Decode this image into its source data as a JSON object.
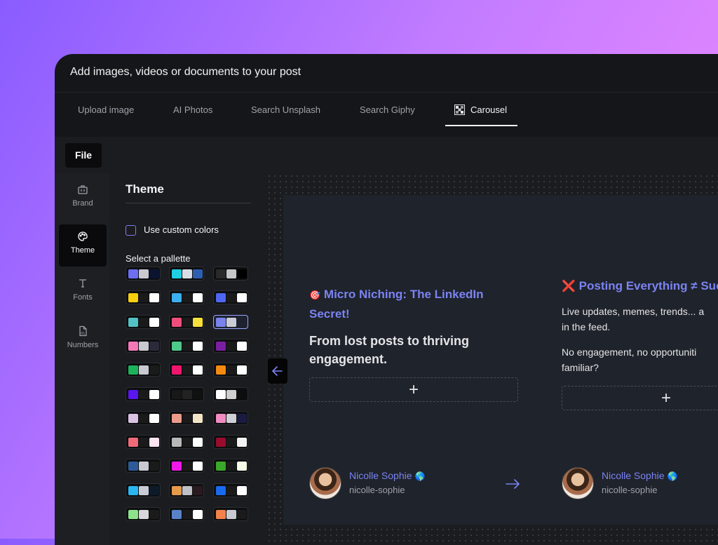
{
  "dialog": {
    "title": "Add images, videos or documents to your post"
  },
  "tabs": [
    {
      "label": "Upload image"
    },
    {
      "label": "AI Photos"
    },
    {
      "label": "Search Unsplash"
    },
    {
      "label": "Search Giphy"
    },
    {
      "label": "Carousel",
      "icon": "carousel-icon",
      "active": true
    }
  ],
  "toolbar": {
    "file_label": "File"
  },
  "nav": [
    {
      "label": "Brand",
      "icon": "briefcase-icon"
    },
    {
      "label": "Theme",
      "icon": "palette-icon",
      "active": true
    },
    {
      "label": "Fonts",
      "icon": "type-icon"
    },
    {
      "label": "Numbers",
      "icon": "numbers-icon"
    }
  ],
  "theme_panel": {
    "title": "Theme",
    "custom_colors_label": "Use custom colors",
    "custom_colors_checked": false,
    "palette_label": "Select a pallette",
    "selected_palette": 8,
    "palettes": [
      [
        "#6b6ff0",
        "#c9c9d1",
        "#0a1430"
      ],
      [
        "#1fd0e3",
        "#d8dde6",
        "#2d5fb0"
      ],
      [
        "#2a2a2a",
        "#c7c7c7",
        "#000000"
      ],
      [
        "#f7d10e",
        "#1a1a1a",
        "#ffffff"
      ],
      [
        "#3bb0f0",
        "#1a1a1a",
        "#ffffff"
      ],
      [
        "#4f67f0",
        "#1a1a1a",
        "#ffffff"
      ],
      [
        "#53c1c4",
        "#1a1a1a",
        "#ffffff"
      ],
      [
        "#ef4e7b",
        "#1a1a1a",
        "#f7e03a"
      ],
      [
        "#7a82ee",
        "#c9ccd6",
        "#1e2230"
      ],
      [
        "#f478b8",
        "#c9c9d1",
        "#2a2a3a"
      ],
      [
        "#4ec98a",
        "#1a1a1a",
        "#ffffff"
      ],
      [
        "#7b1fa2",
        "#1a1a1a",
        "#ffffff"
      ],
      [
        "#1cb35a",
        "#c9c9d1",
        "#1a1a1a"
      ],
      [
        "#f0166e",
        "#1a1a1a",
        "#ffffff"
      ],
      [
        "#f58a12",
        "#1a1a1a",
        "#ffffff"
      ],
      [
        "#5a16f0",
        "#1a1a1a",
        "#ffffff"
      ],
      [
        "#181818",
        "#222222",
        "#111111"
      ],
      [
        "#ffffff",
        "#cfcfcf",
        "#0d0d0d"
      ],
      [
        "#d9c2e3",
        "#1a1a1a",
        "#ffffff"
      ],
      [
        "#ec9a8a",
        "#1a1a1a",
        "#f3e4c8"
      ],
      [
        "#f08cc2",
        "#cfcfd6",
        "#1a1b40"
      ],
      [
        "#f06a78",
        "#1a1a1a",
        "#fbe3ef"
      ],
      [
        "#b8b8b8",
        "#1a1a1a",
        "#ffffff"
      ],
      [
        "#9a0c2e",
        "#1a1a1a",
        "#f3f3f3"
      ],
      [
        "#2d5b9a",
        "#c9c9d1",
        "#1a1a1a"
      ],
      [
        "#f018e8",
        "#1a1a1a",
        "#ffffff"
      ],
      [
        "#3aa82a",
        "#1a1a1a",
        "#f6fbe8"
      ],
      [
        "#2ab6f0",
        "#c9ccd6",
        "#0d1a2a"
      ],
      [
        "#e49a4a",
        "#bfbfc6",
        "#2a1a20"
      ],
      [
        "#1a6af0",
        "#1a1a1a",
        "#ffffff"
      ],
      [
        "#8de38a",
        "#d6d6dc",
        "#1a1a1a"
      ],
      [
        "#5a82c8",
        "#1a1a1a",
        "#ffffff"
      ],
      [
        "#f3814a",
        "#c9c9d1",
        "#1a1a1a"
      ]
    ]
  },
  "slides": [
    {
      "heading_emoji": "🎯",
      "heading": "Micro Niching: The LinkedIn Secret!",
      "heading_line1": "Micro Niching: The LinkedIn",
      "heading_line2": "Secret!",
      "subheading_line1": "From lost posts to thriving",
      "subheading_line2": "engagement.",
      "add_label": "+",
      "author_name": "Nicolle Sophie",
      "author_handle": "nicolle-sophie",
      "author_flag": "🌎"
    },
    {
      "heading_emoji": "❌",
      "heading": "Posting Everything ≠ Suc",
      "body1_line1": "Live updates, memes, trends... a",
      "body1_line2": "in the feed.",
      "body2_line1": "No engagement, no opportuniti",
      "body2_line2": "familiar?",
      "add_label": "+",
      "author_name": "Nicolle Sophie",
      "author_handle": "nicolle-sophie",
      "author_flag": "🌎"
    }
  ]
}
